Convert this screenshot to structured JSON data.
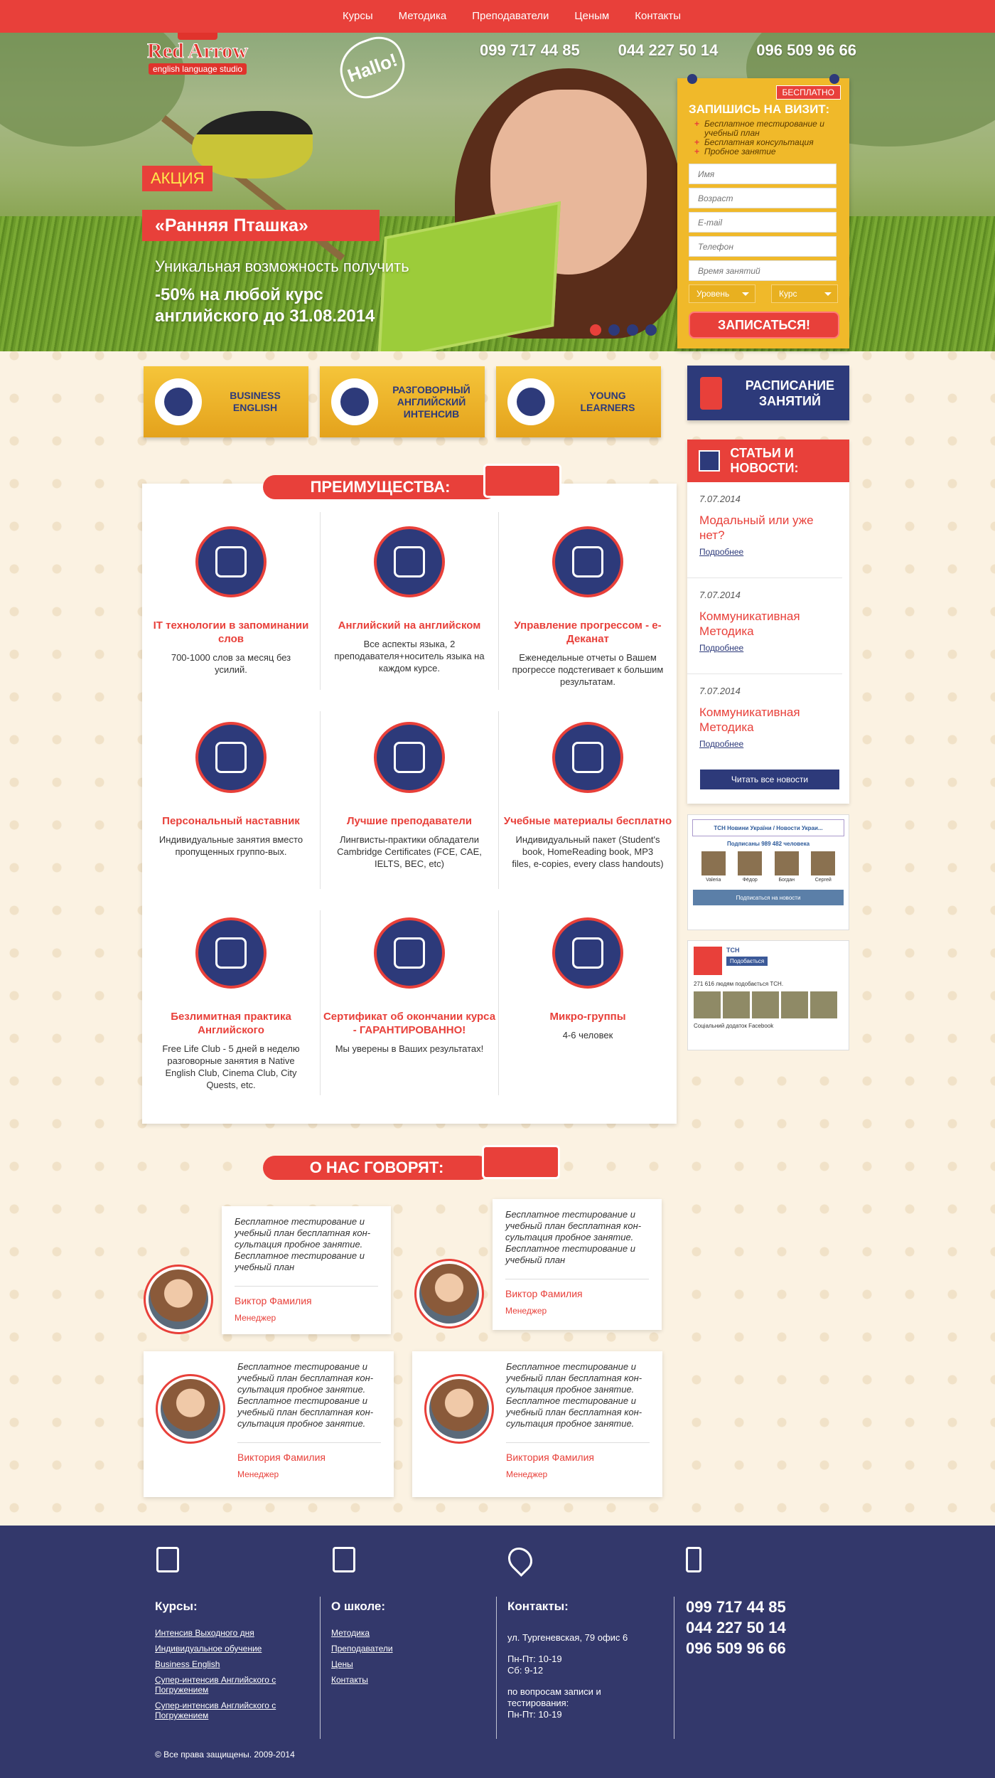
{
  "nav": [
    "Курсы",
    "Методика",
    "Преподаватели",
    "Ценым",
    "Контакты"
  ],
  "logo": {
    "brand": "Red Arrow",
    "sub": "english language studio"
  },
  "hallo": "Hallo!",
  "phones": [
    "099 717 44 85",
    "044 227 50 14",
    "096 509 96 66"
  ],
  "promo": {
    "badge": "АКЦИЯ",
    "title": "«Ранняя Пташка»",
    "text": "Уникальная возможность получить",
    "offer1": "-50% на любой курс",
    "offer2": "английского до 31.08.2014"
  },
  "signup": {
    "badge": "БЕСПЛАТНО",
    "title": "ЗАПИШИСЬ НА ВИЗИТ:",
    "perks": [
      "Бесплатное тестирование и учебный план",
      "Бесплатная консультация",
      "Пробное занятие"
    ],
    "placeholders": [
      "Имя",
      "Возраст",
      "E-mail",
      "Телефон",
      "Время занятий"
    ],
    "level": "Уровень",
    "course": "Курс",
    "button": "ЗАПИСАТЬСЯ!"
  },
  "courses": [
    "BUSINESS ENGLISH",
    "РАЗГОВОРНЫЙ АНГЛИЙСКИЙ ИНТЕНСИВ",
    "YOUNG LEARNERS"
  ],
  "schedule": "РАСПИСАНИЕ ЗАНЯТИЙ",
  "news": {
    "title": "СТАТЬИ И НОВОСТИ:",
    "items": [
      {
        "date": "7.07.2014",
        "title": "Модальный или уже нет?",
        "more": "Подробнее"
      },
      {
        "date": "7.07.2014",
        "title": "Коммуникативная Методика",
        "more": "Подробнее"
      },
      {
        "date": "7.07.2014",
        "title": "Коммуникативная Методика",
        "more": "Подробнее"
      }
    ],
    "all": "Читать все новости"
  },
  "vk": {
    "title": "ТСН Новини України / Новости Украи...",
    "count": "Подписаны 989 482 человека",
    "people": [
      "Valeria",
      "Фёдор",
      "Богдан",
      "Сергей"
    ],
    "button": "Подписаться на новости"
  },
  "fb": {
    "name": "ТСН",
    "button": "Подобається",
    "likes": "271 616 людям подобається ТСН.",
    "plugin": "Соціальний додаток Facebook"
  },
  "advantages": {
    "title": "ПРЕИМУЩЕСТВА:",
    "items": [
      {
        "title": "IT технологии в запоминании слов",
        "text": "700-1000 слов за месяц без усилий."
      },
      {
        "title": "Английский на английском",
        "text": "Все аспекты языка, 2 преподавателя+носитель языка на каждом курсе."
      },
      {
        "title": "Управление прогрессом - e-Деканат",
        "text": "Еженедельные отчеты о Вашем прогрессе подстегивает к большим результатам."
      },
      {
        "title": "Персональный наставник",
        "text": "Индивидуальные занятия вместо пропущенных группо-вых."
      },
      {
        "title": "Лучшие преподаватели",
        "text": "Лингвисты-практики обладатели Cambridge Certificates (FCE, CAE, IELTS, BEC, etc)"
      },
      {
        "title": "Учебные материалы бесплатно",
        "text": "Индивидуальный пакет (Student's book, HomeReading book, MP3 files, e-copies, every class handouts)"
      },
      {
        "title": "Безлимитная практика Английского",
        "text": "Free Life Club - 5 дней в неделю разговорные занятия в Native English Club, Cinema Club, City Quests, etc."
      },
      {
        "title": "Сертификат об окончании курса - ГАРАНТИРОВАННО!",
        "text": "Мы уверены в Ваших результатах!"
      },
      {
        "title": "Микро-группы",
        "text": "4-6 человек"
      }
    ]
  },
  "reviews": {
    "title": "О НАС ГОВОРЯТ:",
    "items": [
      {
        "text": "Бесплатное тестирование и учебный план бесплатная кон-сультация пробное занятие. Бесплатное тестирование и учебный план",
        "name": "Виктор Фамилия",
        "role": "Менеджер"
      },
      {
        "text": "Бесплатное тестирование и учебный план бесплатная кон-сультация пробное занятие. Бесплатное тестирование и учебный план",
        "name": "Виктор Фамилия",
        "role": "Менеджер"
      },
      {
        "text": "Бесплатное тестирование и учебный план бесплатная кон-сультация пробное занятие. Бесплатное тестирование и учебный план бесплатная кон-сультация пробное занятие.",
        "name": "Виктория Фамилия",
        "role": "Менеджер"
      },
      {
        "text": "Бесплатное тестирование и учебный план бесплатная кон-сультация пробное занятие. Бесплатное тестирование и учебный план бесплатная кон-сультация пробное занятие.",
        "name": "Виктория Фамилия",
        "role": "Менеджер"
      }
    ]
  },
  "footer": {
    "courses": {
      "title": "Курсы:",
      "links": [
        "Интенсив Выходного дня",
        "Индивидуальное обучение",
        "Business English",
        "Супер-интенсив Английского с Погружением",
        "Супер-интенсив Английского с Погружением"
      ]
    },
    "school": {
      "title": "О школе:",
      "links": [
        "Методика",
        "Преподаватели",
        "Цены",
        "Контакты"
      ]
    },
    "contacts": {
      "title": "Контакты:",
      "address": "ул. Тургеневская, 79 офис 6",
      "hours1": "Пн-Пт:  10-19",
      "hours2": "Сб:  9-12",
      "note": "по вопросам записи и тестирования:",
      "hours3": "Пн-Пт:  10-19"
    },
    "phones": [
      "099 717 44 85",
      "044 227 50 14",
      "096 509 96 66"
    ],
    "copyright": "© Все права защищены. 2009-2014"
  }
}
